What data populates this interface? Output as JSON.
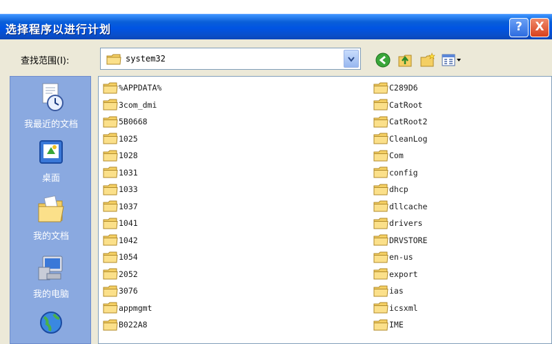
{
  "dialog": {
    "title": "选择程序以进行计划",
    "help_glyph": "?",
    "close_glyph": "X"
  },
  "lookin": {
    "label": "查找范围(I):",
    "value": "system32"
  },
  "toolbar_icons": [
    "back-icon",
    "up-folder-icon",
    "new-folder-icon",
    "view-menu-icon"
  ],
  "places": [
    {
      "label": "我最近的文档",
      "icon": "recent-documents-icon"
    },
    {
      "label": "桌面",
      "icon": "desktop-icon"
    },
    {
      "label": "我的文档",
      "icon": "my-documents-icon"
    },
    {
      "label": "我的电脑",
      "icon": "my-computer-icon"
    },
    {
      "label": "",
      "icon": "network-places-icon"
    }
  ],
  "files": {
    "column_1": [
      "%APPDATA%",
      "3com_dmi",
      "5B0668",
      "1025",
      "1028",
      "1031",
      "1033",
      "1037",
      "1041",
      "1042",
      "1054",
      "2052",
      "3076",
      "appmgmt",
      "B022A8"
    ],
    "column_2": [
      "C289D6",
      "CatRoot",
      "CatRoot2",
      "CleanLog",
      "Com",
      "config",
      "dhcp",
      "dllcache",
      "drivers",
      "DRVSTORE",
      "en-us",
      "export",
      "ias",
      "icsxml",
      "IME"
    ]
  },
  "colors": {
    "titlebar": "#0054e3",
    "dialog_bg": "#ece9d8",
    "places_bg": "#8aa9e0",
    "folder": "#f2c94c"
  }
}
